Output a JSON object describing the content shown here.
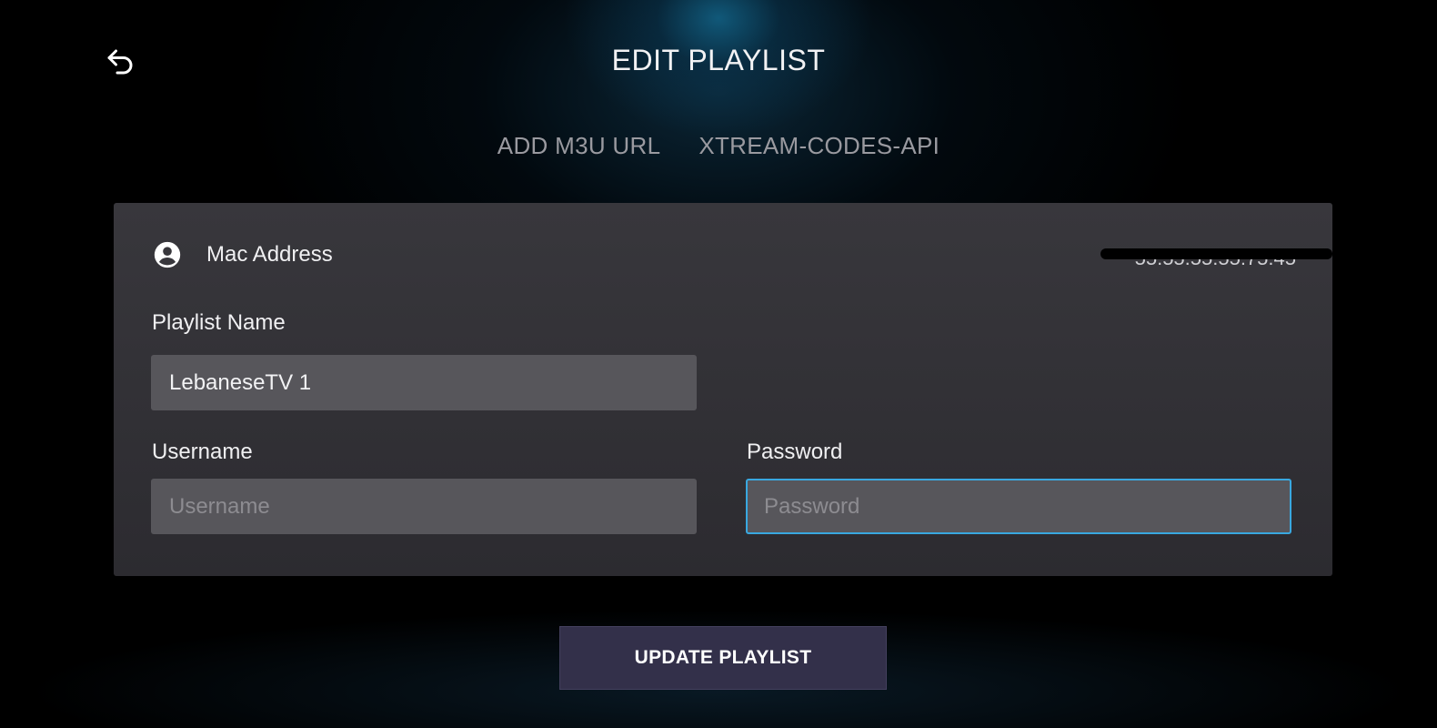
{
  "header": {
    "title": "EDIT PLAYLIST",
    "back_icon": "back-arrow-icon"
  },
  "tabs": [
    {
      "label": "ADD M3U URL"
    },
    {
      "label": "XTREAM-CODES-API"
    }
  ],
  "form": {
    "mac": {
      "label": "Mac Address",
      "icon": "account-circle-icon",
      "value": "55:55:55:55:75:45"
    },
    "playlist_name": {
      "label": "Playlist Name",
      "value": "LebaneseTV 1"
    },
    "username": {
      "label": "Username",
      "value": "",
      "placeholder": "Username"
    },
    "password": {
      "label": "Password",
      "value": "",
      "placeholder": "Password"
    }
  },
  "actions": {
    "update_label": "UPDATE PLAYLIST"
  },
  "colors": {
    "focus_border": "#39a8e0",
    "card_bg": "#38373c",
    "input_bg": "#57565b",
    "button_bg": "#33304a"
  }
}
